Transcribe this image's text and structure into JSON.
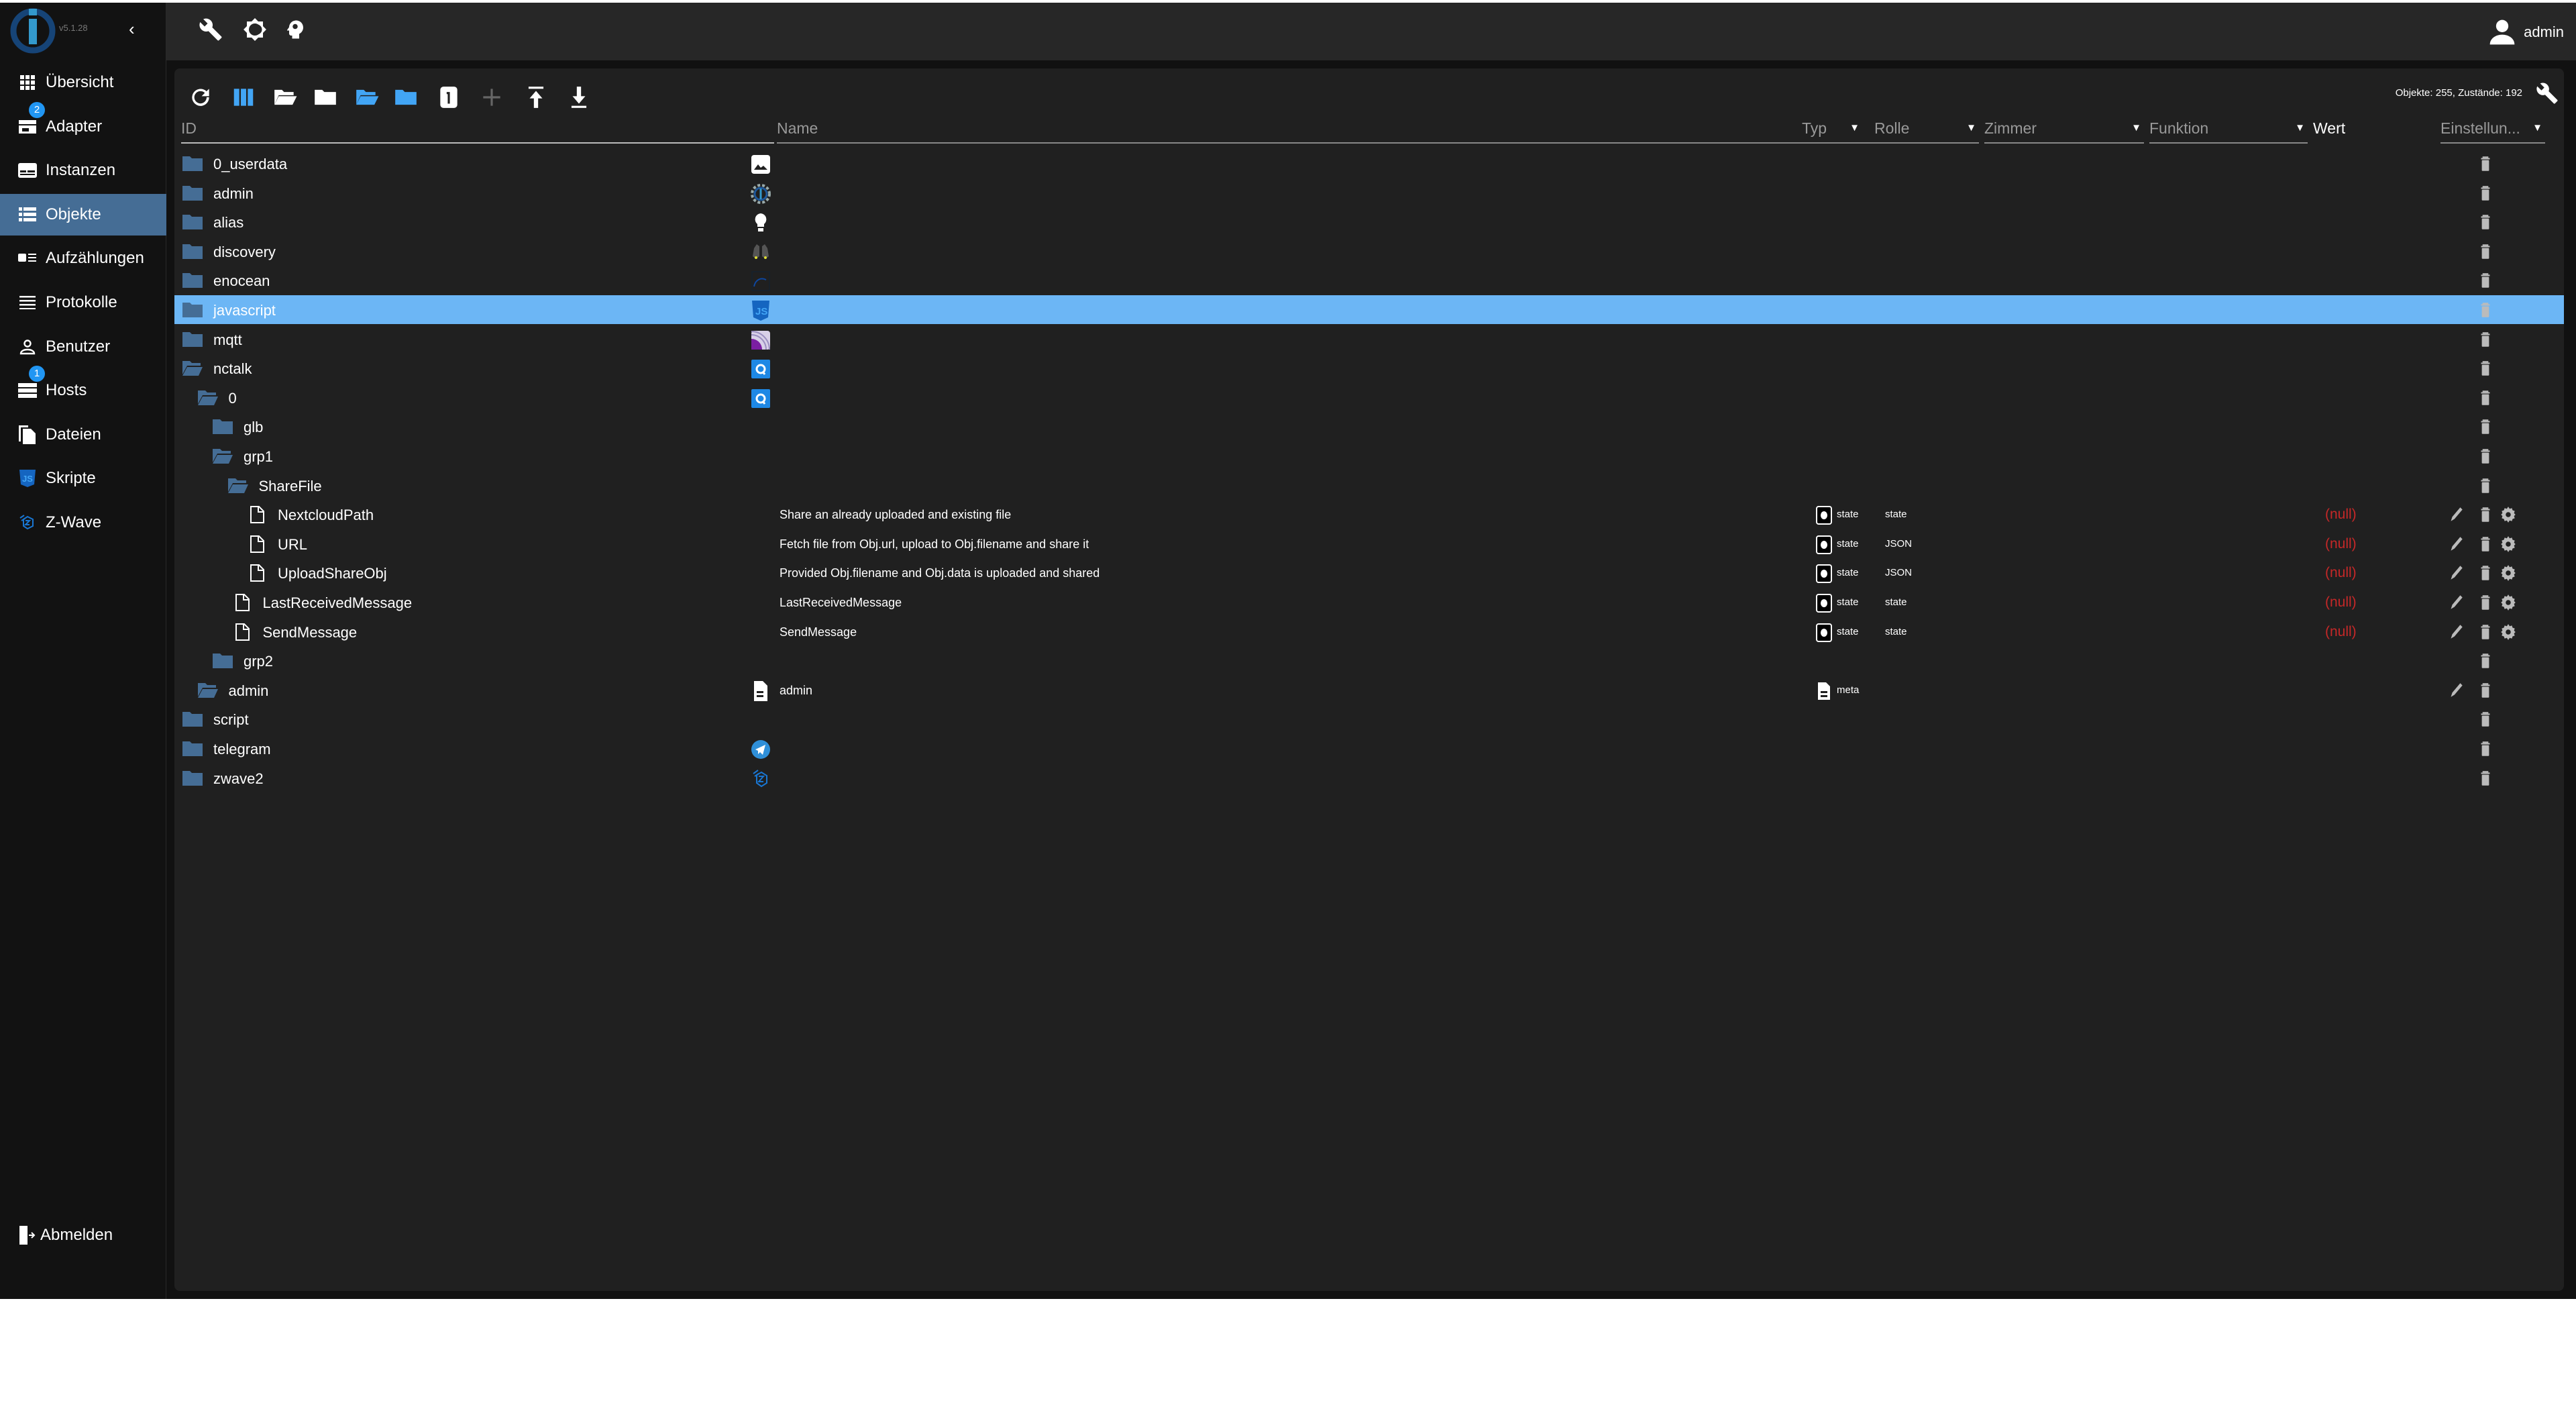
{
  "app": {
    "version": "v5.1.28",
    "user": "admin"
  },
  "colors": {
    "accent": "#2196f3",
    "selected_nav": "#456d95",
    "highlight_row": "#6cb6f5",
    "folder": "#456d95",
    "null_value": "#c62828"
  },
  "sidebar": {
    "items": [
      {
        "label": "Übersicht",
        "icon": "grid-icon"
      },
      {
        "label": "Adapter",
        "icon": "store-icon",
        "badge": "2"
      },
      {
        "label": "Instanzen",
        "icon": "instances-icon"
      },
      {
        "label": "Objekte",
        "icon": "list-icon",
        "selected": true
      },
      {
        "label": "Aufzählungen",
        "icon": "enum-icon"
      },
      {
        "label": "Protokolle",
        "icon": "log-icon"
      },
      {
        "label": "Benutzer",
        "icon": "user-icon"
      },
      {
        "label": "Hosts",
        "icon": "hosts-icon",
        "badge": "1"
      },
      {
        "label": "Dateien",
        "icon": "files-icon"
      },
      {
        "label": "Skripte",
        "icon": "js-icon"
      },
      {
        "label": "Z-Wave",
        "icon": "zwave-icon"
      }
    ],
    "logout": "Abmelden"
  },
  "topbar": {
    "icons": [
      "wrench-icon",
      "theme-icon",
      "expert-mode-icon"
    ]
  },
  "toolbar": {
    "icons": [
      "refresh-icon",
      "columns-icon",
      "folder-open-icon",
      "folder-closed-icon",
      "expand-all-icon",
      "collapse-all-icon",
      "depth-one-icon",
      "add-icon",
      "upload-icon",
      "download-icon"
    ],
    "stats": "Objekte: 255, Zustände: 192"
  },
  "columns": {
    "id": "ID",
    "name": "Name",
    "type": "Typ",
    "role": "Rolle",
    "room": "Zimmer",
    "function": "Funktion",
    "value": "Wert",
    "settings": "Einstellun..."
  },
  "rows": [
    {
      "id": "0_userdata",
      "level": 0,
      "icon": "folder",
      "name_icon": "image-icon",
      "actions": "d"
    },
    {
      "id": "admin",
      "level": 0,
      "icon": "folder",
      "name_icon": "iobroker-admin-icon",
      "actions": "d"
    },
    {
      "id": "alias",
      "level": 0,
      "icon": "folder",
      "name_icon": "lightbulb-icon",
      "actions": "d"
    },
    {
      "id": "discovery",
      "level": 0,
      "icon": "folder",
      "name_icon": "binoculars-icon",
      "actions": "d"
    },
    {
      "id": "enocean",
      "level": 0,
      "icon": "folder",
      "name_icon": "enocean-icon",
      "actions": "d"
    },
    {
      "id": "javascript",
      "level": 0,
      "icon": "folder",
      "name_icon": "javascript-icon",
      "actions": "d",
      "selected": true
    },
    {
      "id": "mqtt",
      "level": 0,
      "icon": "folder",
      "name_icon": "mqtt-icon",
      "actions": "d"
    },
    {
      "id": "nctalk",
      "level": 0,
      "icon": "folder-open",
      "name_icon": "nctalk-icon",
      "actions": "d"
    },
    {
      "id": "0",
      "level": 1,
      "icon": "folder-open",
      "name_icon": "nctalk-icon",
      "actions": "d"
    },
    {
      "id": "glb",
      "level": 2,
      "icon": "folder",
      "actions": "d"
    },
    {
      "id": "grp1",
      "level": 2,
      "icon": "folder-open",
      "actions": "d"
    },
    {
      "id": "ShareFile",
      "level": 3,
      "icon": "folder-open",
      "actions": "d"
    },
    {
      "id": "NextcloudPath",
      "level": 4,
      "icon": "file",
      "name": "Share an already uploaded and existing file",
      "type": "state",
      "role": "state",
      "value": "(null)",
      "actions": "eds"
    },
    {
      "id": "URL",
      "level": 4,
      "icon": "file",
      "name": "Fetch file from Obj.url, upload to Obj.filename and share it",
      "type": "state",
      "role": "JSON",
      "value": "(null)",
      "actions": "eds"
    },
    {
      "id": "UploadShareObj",
      "level": 4,
      "icon": "file",
      "name": "Provided Obj.filename and Obj.data is uploaded and shared",
      "type": "state",
      "role": "JSON",
      "value": "(null)",
      "actions": "eds"
    },
    {
      "id": "LastReceivedMessage",
      "level": 3,
      "icon": "file",
      "name": "LastReceivedMessage",
      "type": "state",
      "role": "state",
      "value": "(null)",
      "actions": "eds"
    },
    {
      "id": "SendMessage",
      "level": 3,
      "icon": "file",
      "name": "SendMessage",
      "type": "state",
      "role": "state",
      "value": "(null)",
      "actions": "eds"
    },
    {
      "id": "grp2",
      "level": 2,
      "icon": "folder",
      "actions": "d"
    },
    {
      "id": "admin",
      "level": 1,
      "icon": "folder-open",
      "name_icon": "meta-file-icon",
      "name": "admin",
      "type": "meta",
      "actions": "ed"
    },
    {
      "id": "script",
      "level": 0,
      "icon": "folder",
      "actions": "d"
    },
    {
      "id": "telegram",
      "level": 0,
      "icon": "folder",
      "name_icon": "telegram-icon",
      "actions": "d"
    },
    {
      "id": "zwave2",
      "level": 0,
      "icon": "folder",
      "name_icon": "zwave-icon",
      "actions": "d"
    }
  ]
}
